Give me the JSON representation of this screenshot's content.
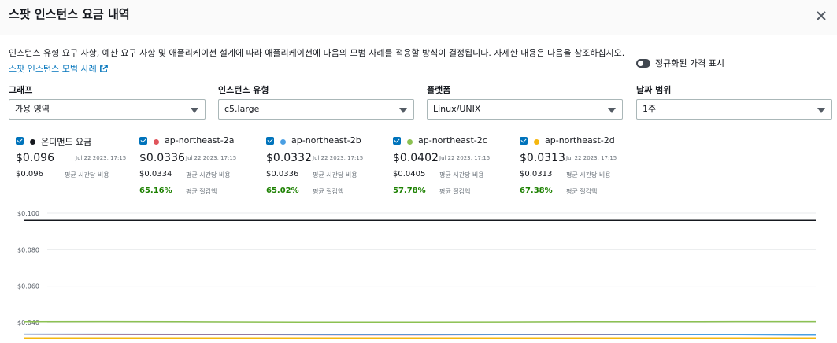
{
  "modal": {
    "title": "스팟 인스턴스 요금 내역",
    "description": "인스턴스 유형 요구 사항, 예산 요구 사항 및 애플리케이션 설계에 따라 애플리케이션에 다음의 모범 사례를 적용할 방식이 결정됩니다. 자세한 내용은 다음을 참조하십시오.",
    "link_text": "스팟 인스턴스 모범 사례",
    "toggle_label": "정규화된 가격 표시"
  },
  "filters": {
    "graph": {
      "label": "그래프",
      "value": "가용 영역"
    },
    "instance_type": {
      "label": "인스턴스 유형",
      "value": "c5.large"
    },
    "platform": {
      "label": "플랫폼",
      "value": "Linux/UNIX"
    },
    "date_range": {
      "label": "날짜 범위",
      "value": "1주"
    }
  },
  "series": [
    {
      "name": "온디맨드 요금",
      "color": "#16191f",
      "price": "$0.096",
      "date": "Jul 22 2023, 17:15",
      "avg": "$0.096",
      "avg_label": "평균 시간당 비용",
      "savings": "",
      "savings_label": ""
    },
    {
      "name": "ap-northeast-2a",
      "color": "#e0555c",
      "price": "$0.0336",
      "date": "Jul 22 2023, 17:15",
      "avg": "$0.0334",
      "avg_label": "평균 시간당 비용",
      "savings": "65.16%",
      "savings_label": "평균 절감액"
    },
    {
      "name": "ap-northeast-2b",
      "color": "#4a9fe3",
      "price": "$0.0332",
      "date": "Jul 22 2023, 17:15",
      "avg": "$0.0336",
      "avg_label": "평균 시간당 비용",
      "savings": "65.02%",
      "savings_label": "평균 절감액"
    },
    {
      "name": "ap-northeast-2c",
      "color": "#8cc152",
      "price": "$0.0402",
      "date": "Jul 22 2023, 17:15",
      "avg": "$0.0405",
      "avg_label": "평균 시간당 비용",
      "savings": "57.78%",
      "savings_label": "평균 절감액"
    },
    {
      "name": "ap-northeast-2d",
      "color": "#f5b70f",
      "price": "$0.0313",
      "date": "Jul 22 2023, 17:15",
      "avg": "$0.0313",
      "avg_label": "평균 시간당 비용",
      "savings": "67.38%",
      "savings_label": "평균 절감액"
    }
  ],
  "chart_data": {
    "type": "line",
    "yticks": [
      "$0.100",
      "$0.080",
      "$0.060",
      "$0.040"
    ],
    "ytick_values": [
      0.1,
      0.08,
      0.06,
      0.04
    ],
    "ylim": [
      0.032,
      0.1
    ],
    "grid": true,
    "series": [
      {
        "name": "온디맨드 요금",
        "color": "#16191f",
        "values": [
          0.096,
          0.096,
          0.096,
          0.096,
          0.096,
          0.096,
          0.096,
          0.096,
          0.096,
          0.096,
          0.096
        ]
      },
      {
        "name": "ap-northeast-2c",
        "color": "#8cc152",
        "values": [
          0.0405,
          0.0406,
          0.0405,
          0.0404,
          0.0403,
          0.0403,
          0.0404,
          0.0405,
          0.0405,
          0.0406,
          0.0406
        ]
      },
      {
        "name": "ap-northeast-2a",
        "color": "#e0555c",
        "values": [
          0.0336,
          0.0335,
          0.0334,
          0.0334,
          0.0333,
          0.0333,
          0.0334,
          0.0334,
          0.0334,
          0.0335,
          0.0336
        ]
      },
      {
        "name": "ap-northeast-2b",
        "color": "#4a9fe3",
        "values": [
          0.0337,
          0.0337,
          0.0336,
          0.0336,
          0.0335,
          0.0335,
          0.0335,
          0.0336,
          0.0335,
          0.0334,
          0.0332
        ]
      },
      {
        "name": "ap-northeast-2d",
        "color": "#f5b70f",
        "values": [
          0.0313,
          0.0313,
          0.0313,
          0.0313,
          0.0313,
          0.0313,
          0.0313,
          0.0313,
          0.0313,
          0.0313,
          0.0313
        ]
      }
    ]
  }
}
